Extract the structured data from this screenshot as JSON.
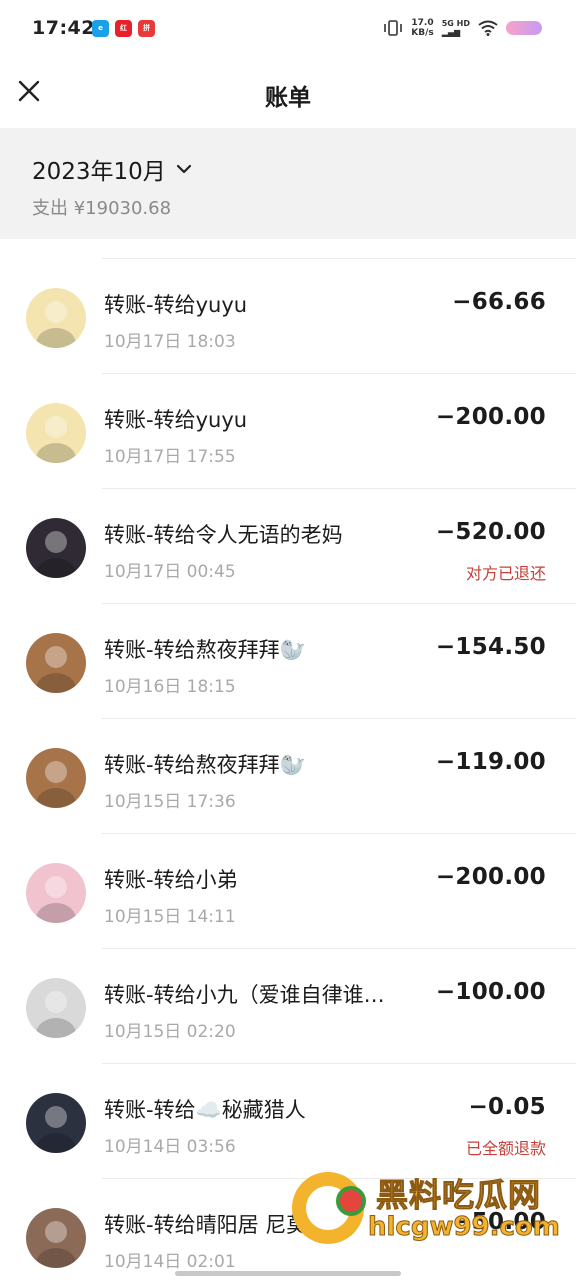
{
  "status_bar": {
    "time": "17:42",
    "net_speed_value": "17.0",
    "net_speed_unit": "KB/s",
    "sig_top": "5G HD",
    "sig_bottom": "▂▄▆"
  },
  "header": {
    "title": "账单"
  },
  "summary": {
    "month": "2023年10月",
    "expense": "支出 ¥19030.68"
  },
  "transactions": [
    {
      "title": "转账-转给yuyu",
      "time": "10月17日 18:03",
      "amount": "−66.66",
      "status": "",
      "avatar_color": "#f3e4b0"
    },
    {
      "title": "转账-转给yuyu",
      "time": "10月17日 17:55",
      "amount": "−200.00",
      "status": "",
      "avatar_color": "#f3e4b0"
    },
    {
      "title": "转账-转给令人无语的老妈",
      "time": "10月17日 00:45",
      "amount": "−520.00",
      "status": "对方已退还",
      "avatar_color": "#2f2a33"
    },
    {
      "title": "转账-转给熬夜拜拜🦭",
      "time": "10月16日 18:15",
      "amount": "−154.50",
      "status": "",
      "avatar_color": "#a7744a"
    },
    {
      "title": "转账-转给熬夜拜拜🦭",
      "time": "10月15日 17:36",
      "amount": "−119.00",
      "status": "",
      "avatar_color": "#a7744a"
    },
    {
      "title": "转账-转给小弟",
      "time": "10月15日 14:11",
      "amount": "−200.00",
      "status": "",
      "avatar_color": "#f0c3cf"
    },
    {
      "title": "转账-转给小九（爱谁自律谁…",
      "time": "10月15日 02:20",
      "amount": "−100.00",
      "status": "",
      "avatar_color": "#d9d9d9"
    },
    {
      "title": "转账-转给☁️秘藏猎人",
      "time": "10月14日 03:56",
      "amount": "−0.05",
      "status": "已全额退款",
      "avatar_color": "#2c3140"
    },
    {
      "title": "转账-转给晴阳居 尼莫 五司",
      "time": "10月14日 02:01",
      "amount": "−50.00",
      "status": "",
      "avatar_color": "#8c6a58"
    }
  ],
  "watermark": {
    "text": "黑料吃瓜网",
    "url": "hlcgw99.com"
  },
  "colors": {
    "accent_red": "#c6403a",
    "summary_bg": "#f2f2f2",
    "watermark_gold": "#f4b32c"
  }
}
